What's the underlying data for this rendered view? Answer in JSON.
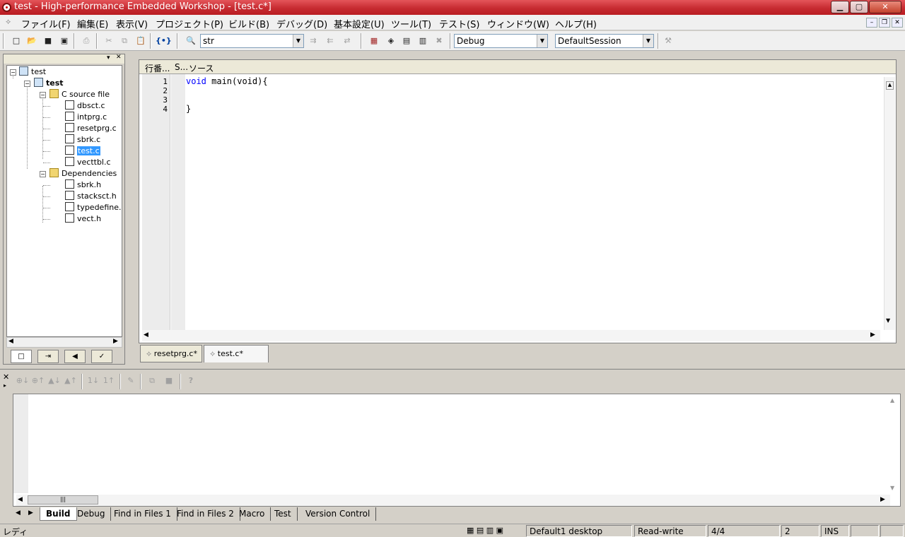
{
  "window": {
    "title": "test - High-performance Embedded Workshop - [test.c*]",
    "controls": {
      "minimize": "▁",
      "maximize": "▢",
      "close": "✕"
    },
    "mdi_controls": {
      "minimize": "–",
      "restore": "❐",
      "close": "✕"
    }
  },
  "menu": {
    "items": [
      "ファイル(F)",
      "編集(E)",
      "表示(V)",
      "プロジェクト(P)",
      "ビルド(B)",
      "デバッグ(D)",
      "基本設定(U)",
      "ツール(T)",
      "テスト(S)",
      "ウィンドウ(W)",
      "ヘルプ(H)"
    ]
  },
  "toolbar": {
    "find_combo_value": "str",
    "config_combo_value": "Debug",
    "session_combo_value": "DefaultSession",
    "icons": {
      "new": "□",
      "open": "📂",
      "save": "■",
      "save_all": "▣",
      "print": "⎙",
      "cut": "✂",
      "copy": "⧉",
      "paste": "📋",
      "bracket": "{•}",
      "find": "🔍",
      "find_next": "⇉",
      "find_prev": "⇇",
      "replace": "⇄",
      "build1": "▦",
      "build2": "◈",
      "build3": "▤",
      "build4": "▥",
      "stop": "✖",
      "tool": "⚒"
    }
  },
  "workspace": {
    "tree": {
      "root": "test",
      "project": "test",
      "folder_source": "C source file",
      "source_files": [
        "dbsct.c",
        "intprg.c",
        "resetprg.c",
        "sbrk.c",
        "test.c",
        "vecttbl.c"
      ],
      "folder_deps": "Dependencies",
      "dependency_files": [
        "sbrk.h",
        "stacksct.h",
        "typedefine.h",
        "vect.h"
      ],
      "selected": "test.c"
    },
    "tabs": [
      "□",
      "⇥",
      "◀",
      "✓"
    ]
  },
  "editor": {
    "headers": {
      "line": "行番...",
      "s": "S...",
      "source": "ソース"
    },
    "lines": [
      {
        "num": "1",
        "keyword": "void",
        "rest": " main(void){"
      },
      {
        "num": "2",
        "keyword": "",
        "rest": ""
      },
      {
        "num": "3",
        "keyword": "",
        "rest": ""
      },
      {
        "num": "4",
        "keyword": "",
        "rest": "}"
      }
    ],
    "tabs": [
      {
        "label": "resetprg.c*",
        "active": false
      },
      {
        "label": "test.c*",
        "active": true
      }
    ]
  },
  "output": {
    "tools": [
      "⊕↓",
      "⊕↑",
      "▲↓",
      "▲↑",
      "1↓",
      "1↑",
      "✎",
      "⧉",
      "■",
      "?"
    ],
    "tabs": [
      "Build",
      "Debug",
      "Find in Files 1",
      "Find in Files 2",
      "Macro",
      "Test",
      "Version Control"
    ],
    "active_tab": "Build"
  },
  "status": {
    "left": "レディ",
    "desktop": "Default1 desktop",
    "mode": "Read-write",
    "position": "4/4",
    "column": "2",
    "ins": "INS"
  }
}
